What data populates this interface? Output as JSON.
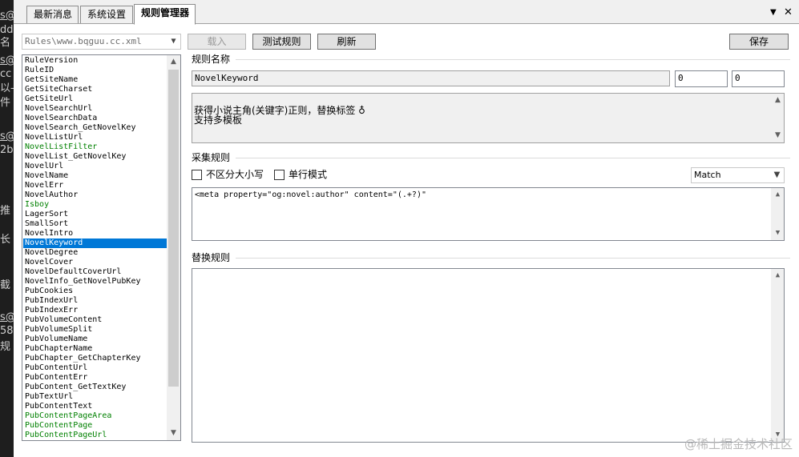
{
  "left_strip": [
    "s@",
    "dd",
    "名",
    "s@",
    "cc",
    "以-",
    "件",
    "s@",
    "2b",
    "推",
    "长",
    "截",
    "s@",
    "58",
    "规"
  ],
  "tabs": [
    {
      "label": "最新消息",
      "active": false
    },
    {
      "label": "系统设置",
      "active": false
    },
    {
      "label": "规则管理器",
      "active": true
    }
  ],
  "window_controls": {
    "dropdown": "▼",
    "close": "✕"
  },
  "rule_file": {
    "value": "Rules\\www.bqguu.cc.xml"
  },
  "toolbar": {
    "load_label": "载入",
    "test_label": "测试规则",
    "refresh_label": "刷新",
    "save_label": "保存"
  },
  "rule_list": [
    {
      "label": "RuleVersion",
      "color": "black"
    },
    {
      "label": "RuleID",
      "color": "black"
    },
    {
      "label": "GetSiteName",
      "color": "black"
    },
    {
      "label": "GetSiteCharset",
      "color": "black"
    },
    {
      "label": "GetSiteUrl",
      "color": "black"
    },
    {
      "label": "NovelSearchUrl",
      "color": "black"
    },
    {
      "label": "NovelSearchData",
      "color": "black"
    },
    {
      "label": "NovelSearch_GetNovelKey",
      "color": "black"
    },
    {
      "label": "NovelListUrl",
      "color": "black"
    },
    {
      "label": "NovelListFilter",
      "color": "green"
    },
    {
      "label": "NovelList_GetNovelKey",
      "color": "black"
    },
    {
      "label": "NovelUrl",
      "color": "black"
    },
    {
      "label": "NovelName",
      "color": "black"
    },
    {
      "label": "NovelErr",
      "color": "black"
    },
    {
      "label": "NovelAuthor",
      "color": "black"
    },
    {
      "label": "Isboy",
      "color": "green"
    },
    {
      "label": "LagerSort",
      "color": "black"
    },
    {
      "label": "SmallSort",
      "color": "black"
    },
    {
      "label": "NovelIntro",
      "color": "black"
    },
    {
      "label": "NovelKeyword",
      "color": "black",
      "selected": true
    },
    {
      "label": "NovelDegree",
      "color": "black"
    },
    {
      "label": "NovelCover",
      "color": "black"
    },
    {
      "label": "NovelDefaultCoverUrl",
      "color": "black"
    },
    {
      "label": "NovelInfo_GetNovelPubKey",
      "color": "black"
    },
    {
      "label": "PubCookies",
      "color": "black"
    },
    {
      "label": "PubIndexUrl",
      "color": "black"
    },
    {
      "label": "PubIndexErr",
      "color": "black"
    },
    {
      "label": "PubVolumeContent",
      "color": "black"
    },
    {
      "label": "PubVolumeSplit",
      "color": "black"
    },
    {
      "label": "PubVolumeName",
      "color": "black"
    },
    {
      "label": "PubChapterName",
      "color": "black"
    },
    {
      "label": "PubChapter_GetChapterKey",
      "color": "black"
    },
    {
      "label": "PubContentUrl",
      "color": "black"
    },
    {
      "label": "PubContentErr",
      "color": "black"
    },
    {
      "label": "PubContent_GetTextKey",
      "color": "black"
    },
    {
      "label": "PubTextUrl",
      "color": "black"
    },
    {
      "label": "PubContentText",
      "color": "black"
    },
    {
      "label": "PubContentPageArea",
      "color": "green"
    },
    {
      "label": "PubContentPage",
      "color": "green"
    },
    {
      "label": "PubContentPageUrl",
      "color": "green"
    }
  ],
  "rule_name": {
    "title": "规则名称",
    "name_value": "NovelKeyword",
    "num1": "0",
    "num2": "0",
    "description": "获得小说主角(关键字)正则，替换标签 ♁\n支持多模板"
  },
  "collect_rule": {
    "title": "采集规则",
    "case_insensitive_label": "不区分大小写",
    "single_line_label": "单行模式",
    "match_mode": "Match",
    "pattern": "<meta property=\"og:novel:author\" content=\"(.+?)\""
  },
  "replace_rule": {
    "title": "替换规则",
    "value": ""
  },
  "watermark": "@稀土掘金技术社区",
  "colors": {
    "selection": "#0078d7",
    "green_item": "#008000",
    "panel_bg": "#f0f0f0"
  }
}
